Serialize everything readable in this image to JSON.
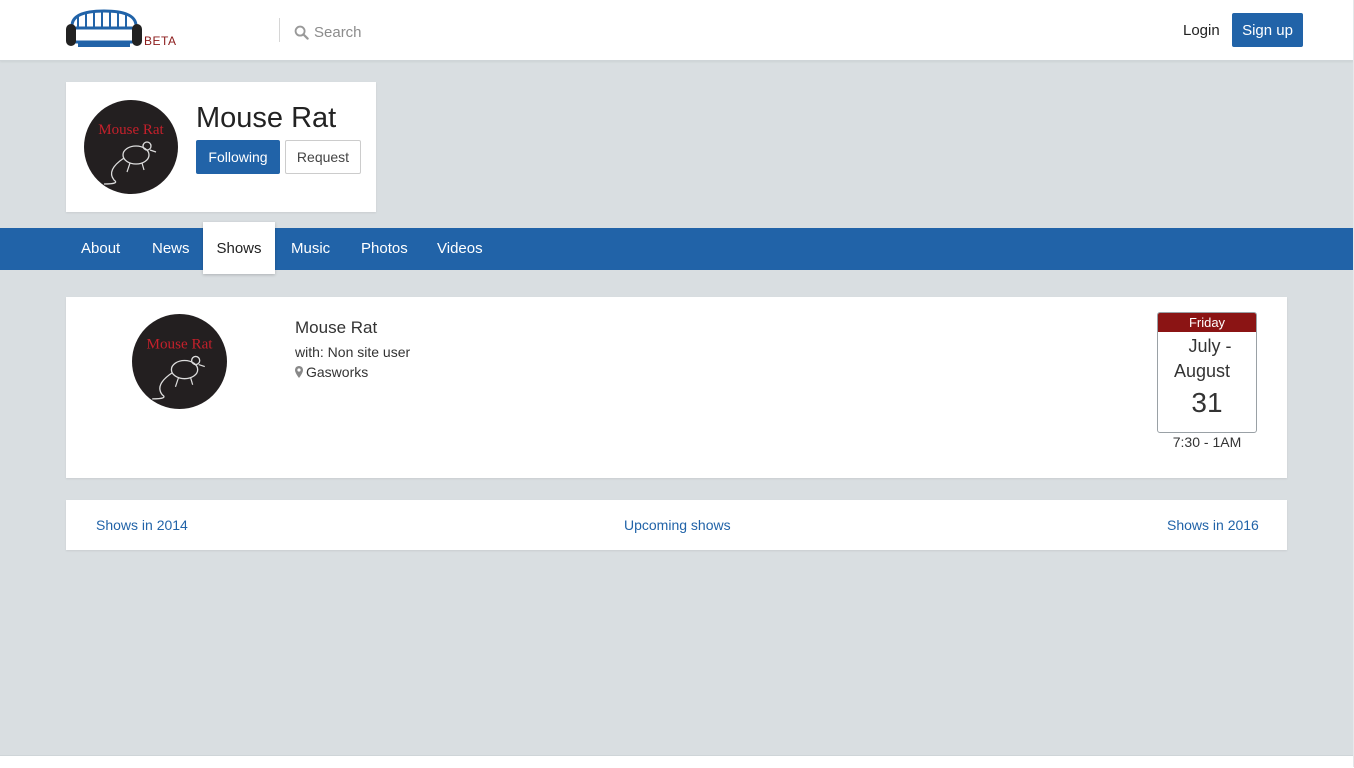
{
  "header": {
    "logo_badge": "BETA",
    "search_placeholder": "Search",
    "login_label": "Login",
    "signup_label": "Sign up"
  },
  "profile": {
    "name": "Mouse Rat",
    "following_label": "Following",
    "request_label": "Request",
    "logo_text": "Mouse Rat"
  },
  "nav": {
    "tabs": [
      {
        "label": "About"
      },
      {
        "label": "News"
      },
      {
        "label": "Shows",
        "active": true
      },
      {
        "label": "Music"
      },
      {
        "label": "Photos"
      },
      {
        "label": "Videos"
      }
    ]
  },
  "show": {
    "title": "Mouse Rat",
    "with": "with: Non site user",
    "venue": "Gasworks",
    "calendar": {
      "weekday": "Friday",
      "month_line1": "July -",
      "month_line2": "August",
      "day": "31"
    },
    "time": "7:30 - 1AM"
  },
  "pager": {
    "prev": "Shows in 2014",
    "current": "Upcoming shows",
    "next": "Shows in 2016"
  },
  "colors": {
    "brand_blue": "#2163a8",
    "page_bg": "#d9dee1",
    "calendar_red": "#8b1414",
    "badge_red": "#8b1a1a"
  }
}
